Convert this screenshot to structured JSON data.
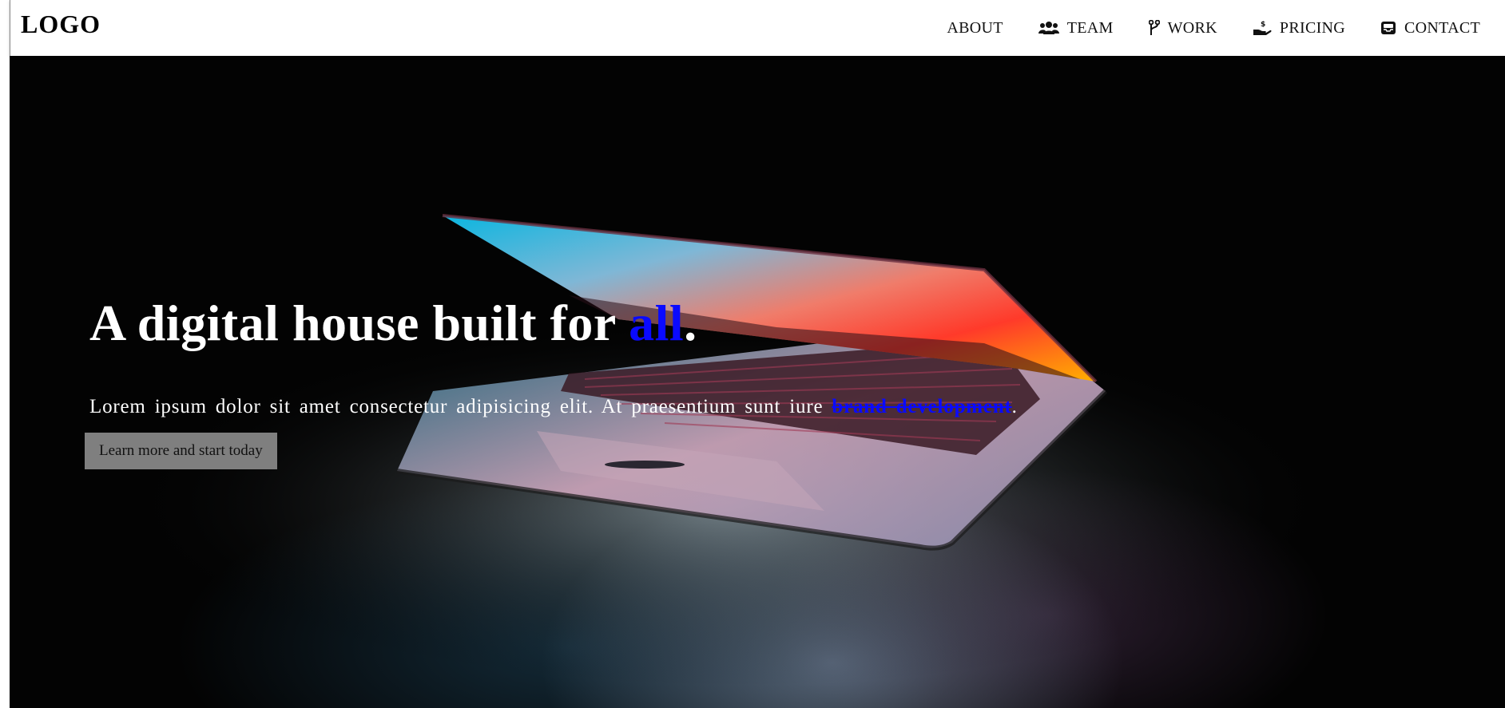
{
  "header": {
    "logo": "LOGO",
    "nav": [
      {
        "label": "ABOUT",
        "icon": ""
      },
      {
        "label": "TEAM",
        "icon": "users-icon"
      },
      {
        "label": "WORK",
        "icon": "code-branch-icon"
      },
      {
        "label": "PRICING",
        "icon": "hand-dollar-icon"
      },
      {
        "label": "CONTACT",
        "icon": "inbox-icon"
      }
    ]
  },
  "hero": {
    "headline_prefix": "A digital house built for ",
    "headline_accent": "all",
    "headline_suffix": ".",
    "lead_prefix": "Lorem ipsum dolor sit amet consectetur adipisicing elit. At praesentium sunt iure ",
    "lead_link": "brand development",
    "lead_suffix": ".",
    "cta_label": "Learn more and start today"
  },
  "colors": {
    "accent": "#0a0aff",
    "hero_background": "#030303",
    "cta_background": "#7f7f7f"
  }
}
